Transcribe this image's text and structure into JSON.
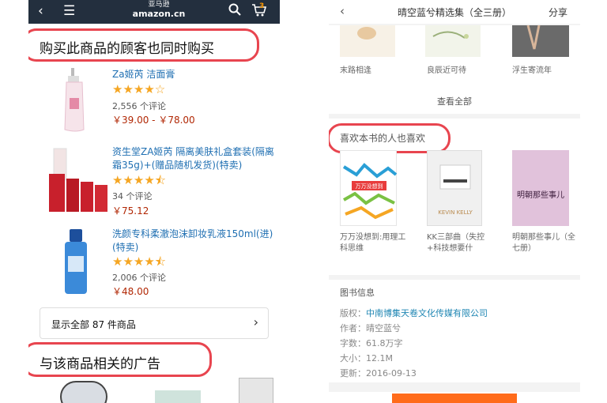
{
  "left_screen": {
    "topbar": {
      "back_icon": "chevron-left-icon",
      "menu_icon": "hamburger-icon",
      "logo_cn": "亚马逊",
      "logo_en": "amazon.cn",
      "search_icon": "search-icon",
      "cart_icon": "cart-icon",
      "cart_count": "3"
    },
    "also_bought_title": "购买此商品的顾客也同时购买",
    "products": [
      {
        "title": "Za姬芮 洁面膏",
        "rating": 4,
        "reviews": "2,556 个评论",
        "price": "￥39.00 - ￥78.00"
      },
      {
        "title": "资生堂ZA姬芮 隔离美肤礼盒套装(隔离霜35g)+(赠品随机发货)(特卖)",
        "rating": 4.5,
        "reviews": "34 个评论",
        "price": "￥75.12"
      },
      {
        "title": "洗颜专科柔澈泡沫卸妆乳液150ml(进)(特卖)",
        "rating": 4.5,
        "reviews": "2,006 个评论",
        "price": "￥48.00"
      }
    ],
    "show_all": "显示全部 87 件商品",
    "ads_title": "与该商品相关的广告",
    "accent_color": "#e8454f"
  },
  "right_screen": {
    "topbar": {
      "back_icon": "chevron-left-icon",
      "title": "晴空蓝兮精选集（全三册）",
      "share": "分享"
    },
    "series_books": [
      "末路相逢",
      "良辰近可待",
      "浮生寄流年"
    ],
    "view_all": "查看全部",
    "also_like_title": "喜欢本书的人也喜欢",
    "recommended": [
      {
        "caption": "万万没想到:用理工科思维",
        "cover_text": "万万没想到"
      },
      {
        "caption": "KK三部曲（失控+科技想要什",
        "cover_text": "KEVIN KELLY"
      },
      {
        "caption": "明朝那些事儿（全七册）",
        "cover_text": "明朝那些事儿"
      }
    ],
    "book_info": {
      "title": "图书信息",
      "rows": [
        {
          "label": "版权：",
          "value": "中南博集天卷文化传媒有限公司"
        },
        {
          "label": "作者：",
          "value": "晴空蓝兮"
        },
        {
          "label": "字数：",
          "value": "61.8万字"
        },
        {
          "label": "大小：",
          "value": "12.1M"
        },
        {
          "label": "更新：",
          "value": "2016-09-13"
        }
      ]
    },
    "accent_color": "#ff6b1a"
  }
}
